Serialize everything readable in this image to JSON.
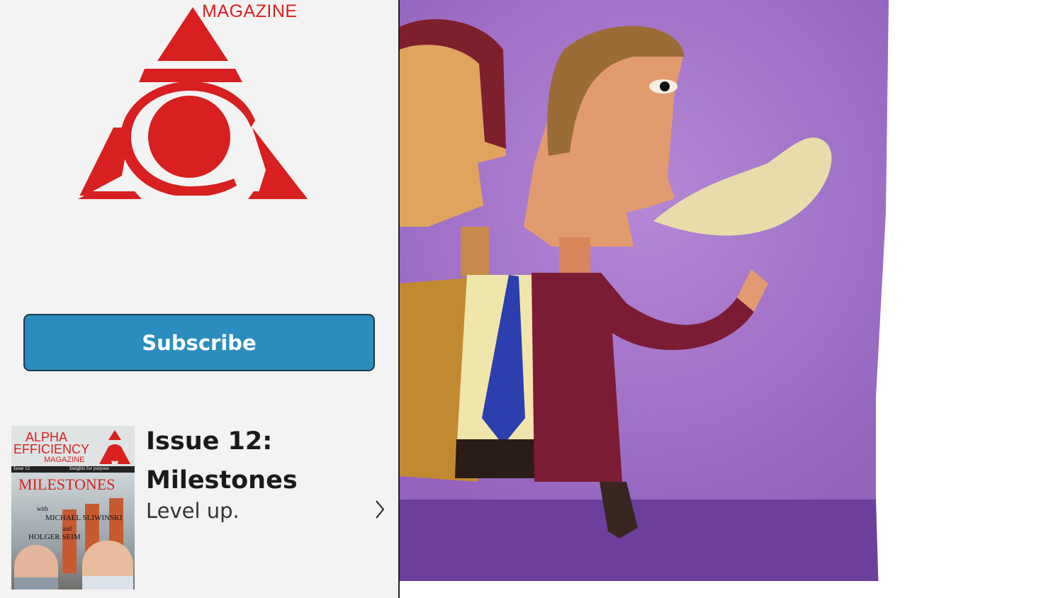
{
  "brand": {
    "magazine_word": "MAGAZINE",
    "color": "#d82020"
  },
  "subscribe": {
    "label": "Subscribe",
    "color": "#2a8dbd"
  },
  "issue": {
    "title_line1": "Issue 12:",
    "title_line2": "Milestones",
    "subtitle": "Level up.",
    "chevron_icon": "chevron-right-icon",
    "cover": {
      "alpha": "ALPHA",
      "efficiency": "EFFICIENCY",
      "magazine": "MAGAZINE",
      "issue_no": "Issue 12",
      "tagline": "Insights for purpose",
      "headline": "MILESTONES",
      "with": "with",
      "name1": "MICHAEL SLIWINSKI",
      "and": "and",
      "name2": "HOLGER SEIM"
    }
  },
  "hero": {
    "icon": "illustration-two-businessmen-speech-bubble",
    "background_color": "#9e6cc4"
  }
}
